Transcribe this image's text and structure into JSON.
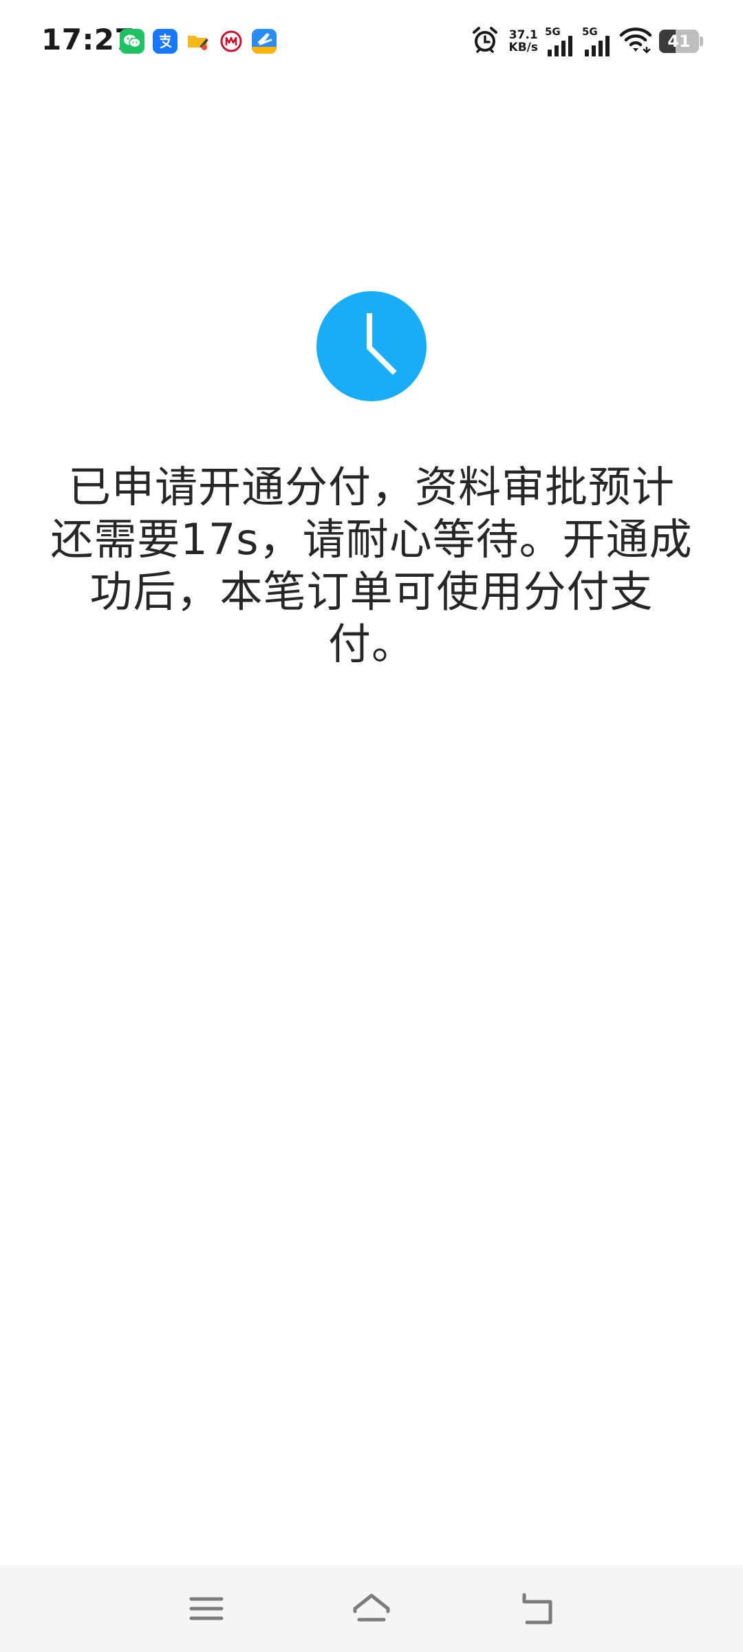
{
  "status_bar": {
    "time": "17:27",
    "app_icons": [
      "wechat-icon",
      "alipay-icon",
      "folder-icon",
      "bank-logo-icon",
      "travel-app-icon"
    ],
    "alarm_icon": "alarm-clock-icon",
    "net_speed": {
      "value": "37.1",
      "unit": "KB/s"
    },
    "sim1": {
      "type": "5G",
      "icon": "signal-strength-icon"
    },
    "sim2": {
      "type": "5G",
      "icon": "signal-strength-icon"
    },
    "wifi_icon": "wifi-icon",
    "battery": {
      "level": "41",
      "fraction": 0.41
    }
  },
  "main": {
    "status_icon": "clock-icon",
    "message": "已申请开通分付，资料审批预计还需要17s，请耐心等待。开通成功后，本笔订单可使用分付支付。"
  },
  "nav_bar": {
    "menu_icon": "menu-icon",
    "home_icon": "home-icon",
    "back_icon": "back-icon"
  },
  "colors": {
    "accent": "#18adf6",
    "text": "#262626",
    "nav_background": "#f5f5f5"
  }
}
